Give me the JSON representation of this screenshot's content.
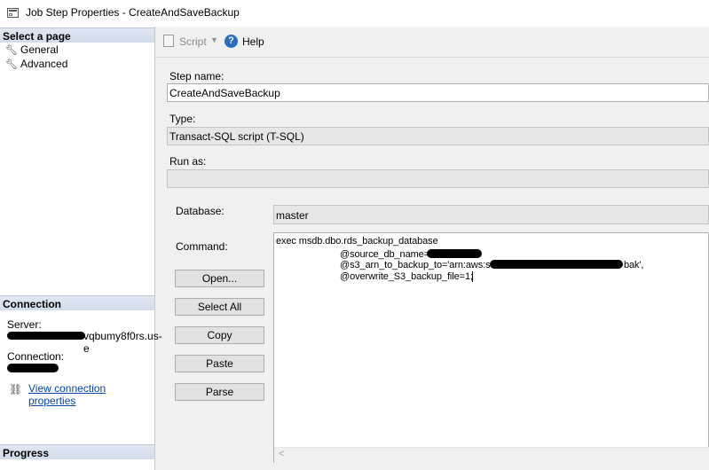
{
  "window": {
    "title": "Job Step Properties - CreateAndSaveBackup"
  },
  "left_pane": {
    "select_page_header": "Select a page",
    "pages": [
      {
        "label": "General",
        "icon": "wrench-icon"
      },
      {
        "label": "Advanced",
        "icon": "wrench-icon"
      }
    ],
    "connection_header": "Connection",
    "server_label": "Server:",
    "server_value_visible": "vqbumy8f0rs.us-e",
    "connection_label": "Connection:",
    "view_connection_link": "View connection properties",
    "progress_header": "Progress"
  },
  "toolbar": {
    "script_label": "Script",
    "help_label": "Help"
  },
  "form": {
    "step_name_label": "Step name:",
    "step_name_value": "CreateAndSaveBackup",
    "type_label": "Type:",
    "type_value": "Transact-SQL script (T-SQL)",
    "run_as_label": "Run as:",
    "run_as_value": "",
    "database_label": "Database:",
    "database_value": "master",
    "command_label": "Command:",
    "buttons": {
      "open": "Open...",
      "select_all": "Select All",
      "copy": "Copy",
      "paste": "Paste",
      "parse": "Parse"
    },
    "command_lines": [
      "exec msdb.dbo.rds_backup_database",
      "@source_db_name=",
      "@s3_arn_to_backup_to='arn:aws:s3:::",
      "bak',",
      "@overwrite_S3_backup_file=1;"
    ]
  },
  "colors": {
    "link": "#0645ad",
    "section_header": "#d7e0ec",
    "help_icon": "#2b6cc4"
  }
}
